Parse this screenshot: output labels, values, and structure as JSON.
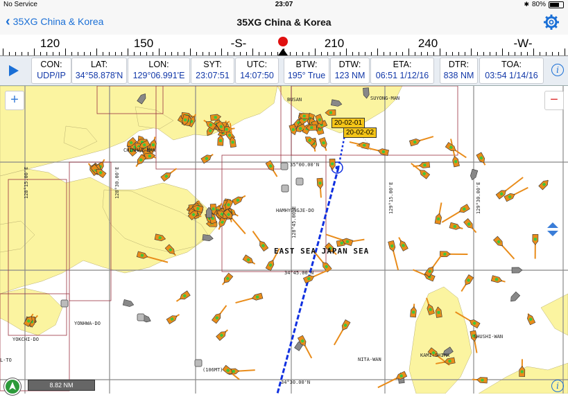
{
  "status": {
    "carrier": "No Service",
    "time": "23:07",
    "battery": "80%"
  },
  "nav": {
    "back_label": "35XG China & Korea",
    "title": "35XG China & Korea"
  },
  "compass": {
    "labels": [
      "120",
      "150",
      "-S-",
      "210",
      "240",
      "-W-"
    ],
    "heading_marker_color": "#e01010"
  },
  "info": [
    {
      "title": "CON:",
      "value": "UDP/IP"
    },
    {
      "title": "LAT:",
      "value": "34°58.878'N"
    },
    {
      "title": "LON:",
      "value": "129°06.991'E"
    },
    {
      "title": "SYT:",
      "value": "23:07:51"
    },
    {
      "title": "UTC:",
      "value": "14:07:50"
    },
    {
      "title": "BTW:",
      "value": "195° True"
    },
    {
      "title": "DTW:",
      "value": "123 NM"
    },
    {
      "title": "ETA:",
      "value": "06:51 1/12/16"
    },
    {
      "title": "DTR:",
      "value": "838 NM"
    },
    {
      "title": "TOA:",
      "value": "03:54 1/14/16"
    }
  ],
  "map": {
    "land_color": "#fbf4a0",
    "vessel_color": "#e98c1a",
    "route_color": "#1030e0",
    "waypoints": [
      "20-02-01",
      "20-02-02"
    ],
    "place_names": [
      "BUSAN",
      "SUYONG-MAN",
      "CHINHAE MAN",
      "HAMHYONGJE-DO",
      "YONHWA-DO",
      "YOKCHI-DO",
      "NITA-WAN",
      "KAMI-SHIMA",
      "SHUSHI-WAN",
      "L-TO",
      "(106MT)"
    ],
    "sea_name": "EAST SEA JAPAN SEA",
    "lat_labels": [
      "35°00.00'N",
      "34°45.00'N",
      "34°30.00'N"
    ],
    "lon_labels": [
      "128°15.00'E",
      "128°30.00'E",
      "128°45.00'E",
      "129°15.00'E",
      "129°30.00'E"
    ],
    "scale": "8.82 NM"
  }
}
